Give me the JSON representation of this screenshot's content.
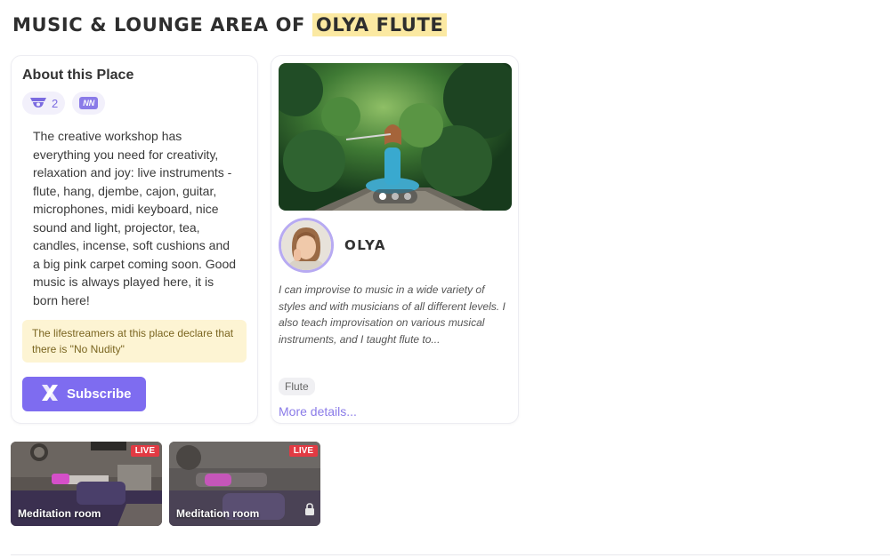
{
  "page": {
    "title_prefix": "MUSIC & LOUNGE AREA OF",
    "title_highlight": "OLYA FLUTE"
  },
  "about": {
    "title": "About this Place",
    "badge_count": "2",
    "badge_tag": "NN",
    "description": "The creative workshop has everything you need for creativity, relaxation and joy: live instruments - flute, hang, djembe, cajon, guitar, microphones, midi keyboard, nice sound and light, projector, tea, candles, incense, soft cushions and a big pink carpet coming soon. Good music is always played here, it is born here!",
    "declaration": "The lifestreamers at this place declare that there is \"No Nudity\"",
    "subscribe_label": "Subscribe"
  },
  "host": {
    "name": "OLYA",
    "description": "I can improvise to music in a wide variety of styles and with musicians of all different levels. I also teach improvisation on various musical instruments, and I taught flute to...",
    "tag": "Flute",
    "more_link": "More details..."
  },
  "rooms": [
    {
      "label": "Meditation room",
      "live": "LIVE"
    },
    {
      "label": "Meditation room",
      "live": "LIVE"
    }
  ],
  "colors": {
    "accent": "#7e6cf0",
    "highlight": "#fbe9a2",
    "live": "#e23a43",
    "notice_bg": "#fdf4d3"
  },
  "icons": {
    "viewers": "camera-icon",
    "subscribe": "x-logo-icon",
    "room_lock": "lock-icon"
  }
}
